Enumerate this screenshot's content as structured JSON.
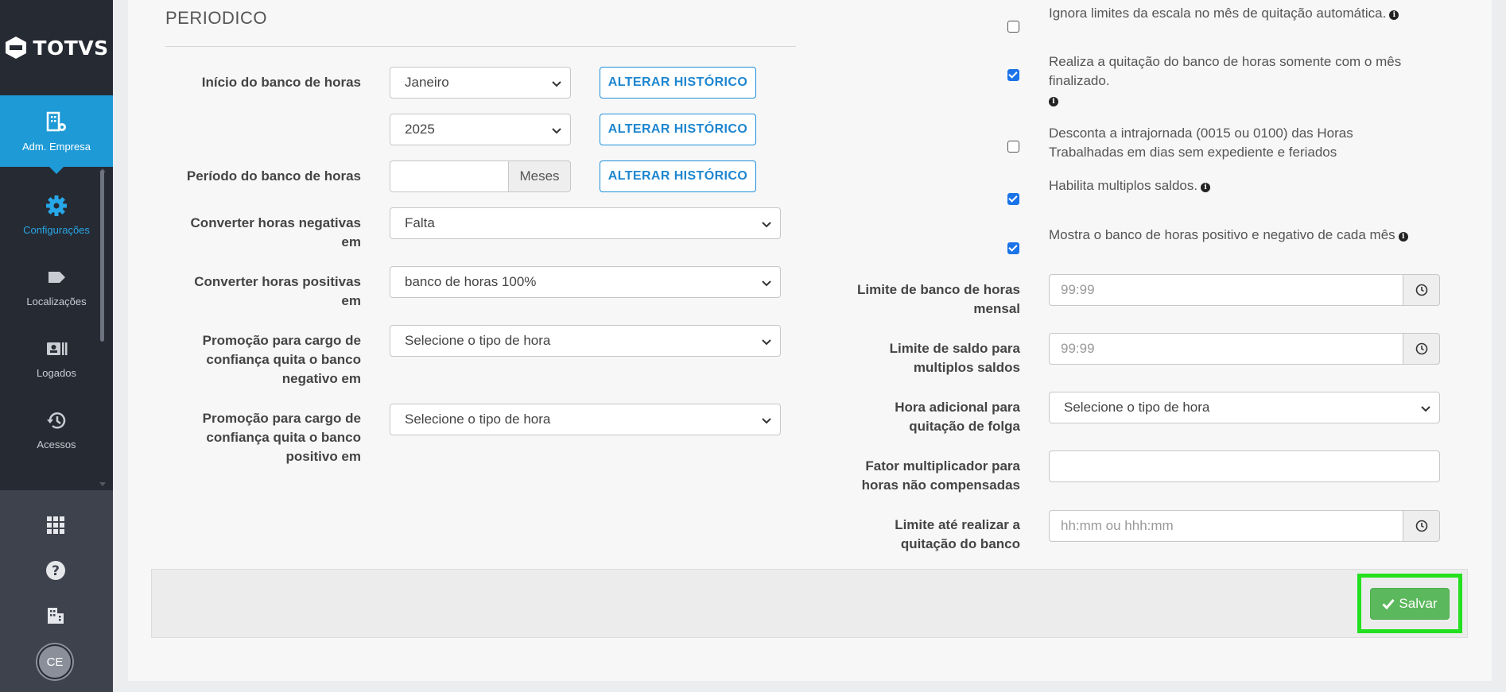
{
  "brand": {
    "name": "TOTVS"
  },
  "sidebar": {
    "items": [
      {
        "label": "Adm. Empresa",
        "icon": "building-gear-icon"
      },
      {
        "label": "Configurações",
        "icon": "gear-icon"
      },
      {
        "label": "Localizações",
        "icon": "tag-icon"
      },
      {
        "label": "Logados",
        "icon": "id-card-icon"
      },
      {
        "label": "Acessos",
        "icon": "history-icon"
      }
    ],
    "bottom_icons": [
      "apps-grid-icon",
      "help-icon",
      "company-icon"
    ],
    "avatar_initials": "CE"
  },
  "section": {
    "title": "PERIODICO"
  },
  "form_left": {
    "inicio_label": "Início do banco de horas",
    "inicio_month": "Janeiro",
    "inicio_year": "2025",
    "alterar_label": "ALTERAR HISTÓRICO",
    "periodo_label": "Período do banco de horas",
    "periodo_value": "",
    "periodo_addon": "Meses",
    "conv_neg_label": [
      "Converter horas negativas",
      "em"
    ],
    "conv_neg_value": "Falta",
    "conv_pos_label": [
      "Converter horas positivas",
      "em"
    ],
    "conv_pos_value": "banco de horas 100%",
    "promo_neg_label": [
      "Promoção para cargo de",
      "confiança quita o banco",
      "negativo em"
    ],
    "promo_neg_value": "Selecione o tipo de hora",
    "promo_pos_label": [
      "Promoção para cargo de",
      "confiança quita o banco",
      "positivo em"
    ],
    "promo_pos_value": "Selecione o tipo de hora"
  },
  "checks": [
    {
      "lines": [
        "Ignora limites da escala no mês de quitação automática."
      ],
      "checked": false
    },
    {
      "lines": [
        "Realiza a quitação do banco de horas somente com o mês",
        "finalizado."
      ],
      "checked": true
    },
    {
      "lines": [
        "Desconta a intrajornada (0015 ou 0100) das Horas",
        "Trabalhadas em dias sem expediente e feriados"
      ],
      "checked": false
    },
    {
      "lines": [
        "Habilita multiplos saldos."
      ],
      "checked": true
    },
    {
      "lines": [
        "Mostra o banco de horas positivo e negativo de cada mês"
      ],
      "checked": true
    }
  ],
  "form_right": {
    "limite_mensal_label": [
      "Limite de banco de horas",
      "mensal"
    ],
    "limite_mensal_placeholder": "99:99",
    "limite_saldo_label": [
      "Limite de saldo para",
      "multiplos saldos"
    ],
    "limite_saldo_placeholder": "99:99",
    "hora_adic_label": [
      "Hora adicional para",
      "quitação de folga"
    ],
    "hora_adic_value": "Selecione o tipo de hora",
    "fator_label": [
      "Fator multiplicador para",
      "horas não compensadas"
    ],
    "fator_value": "",
    "limite_quit_label": [
      "Limite até realizar a",
      "quitação do banco"
    ],
    "limite_quit_placeholder": "hh:mm ou hhh:mm"
  },
  "footer": {
    "save_label": "Salvar"
  },
  "colors": {
    "sidebar": "#262a33",
    "active": "#1e9ad6",
    "save": "#5cb85c",
    "highlight": "#22e01e"
  }
}
